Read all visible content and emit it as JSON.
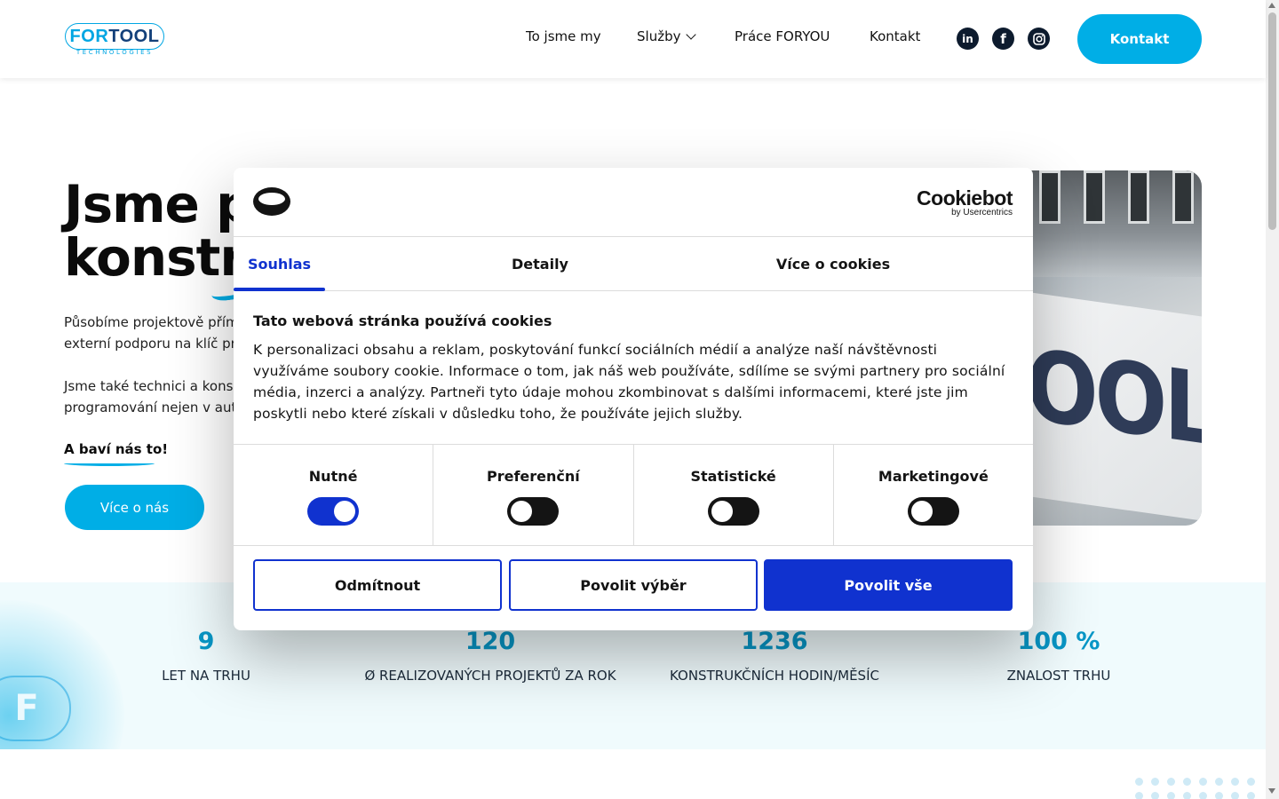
{
  "header": {
    "logo_main_a": "FOR",
    "logo_main_b": "TOOL",
    "logo_sub": "TECHNOLOGIES",
    "nav": [
      "To jsme my",
      "Služby",
      "Práce FORYOU",
      "Kontakt"
    ],
    "social": [
      {
        "icon": "linkedin-icon",
        "glyph": "in"
      },
      {
        "icon": "facebook-icon",
        "glyph": "f"
      },
      {
        "icon": "instagram-icon",
        "glyph": ""
      }
    ],
    "cta": "Kontakt"
  },
  "hero": {
    "title_line1": "Jsme p",
    "title_line2": "konstru",
    "p1_line1": "Působíme projektově přím",
    "p1_line2": "externí podporu na klíč pr",
    "p2_line1": "Jsme také technici a kons",
    "p2_line2": "programování nejen v aut",
    "fun": "A baví nás to!",
    "button": "Více o nás",
    "image_sign_text": "OOL"
  },
  "stats": [
    {
      "value": "9",
      "label": "LET NA TRHU"
    },
    {
      "value": "120",
      "label": "Ø REALIZOVANÝCH PROJEKTŮ ZA ROK"
    },
    {
      "value": "1236",
      "label": "KONSTRUKČNÍCH HODIN/MĚSÍC"
    },
    {
      "value": "100 %",
      "label": "ZNALOST TRHU"
    }
  ],
  "stats_badge": "F",
  "cookie": {
    "brand": "Cookiebot",
    "brand_sub": "by Usercentrics",
    "tabs": [
      "Souhlas",
      "Detaily",
      "Více o cookies"
    ],
    "heading": "Tato webová stránka používá cookies",
    "text": "K personalizaci obsahu a reklam, poskytování funkcí sociálních médií a analýze naší návštěvnosti využíváme soubory cookie. Informace o tom, jak náš web používáte, sdílíme se svými partnery pro sociální média, inzerci a analýzy. Partneři tyto údaje mohou zkombinovat s dalšími informacemi, které jste jim poskytli nebo které získali v důsledku toho, že používáte jejich služby.",
    "categories": [
      {
        "label": "Nutné",
        "enabled": true
      },
      {
        "label": "Preferenční",
        "enabled": false
      },
      {
        "label": "Statistické",
        "enabled": false
      },
      {
        "label": "Marketingové",
        "enabled": false
      }
    ],
    "buttons": {
      "reject": "Odmítnout",
      "allow_selection": "Povolit výběr",
      "allow_all": "Povolit vše"
    }
  },
  "colors": {
    "accent": "#00aee6",
    "cookiebot_blue": "#1032cf",
    "stat_value": "#0897c7"
  }
}
